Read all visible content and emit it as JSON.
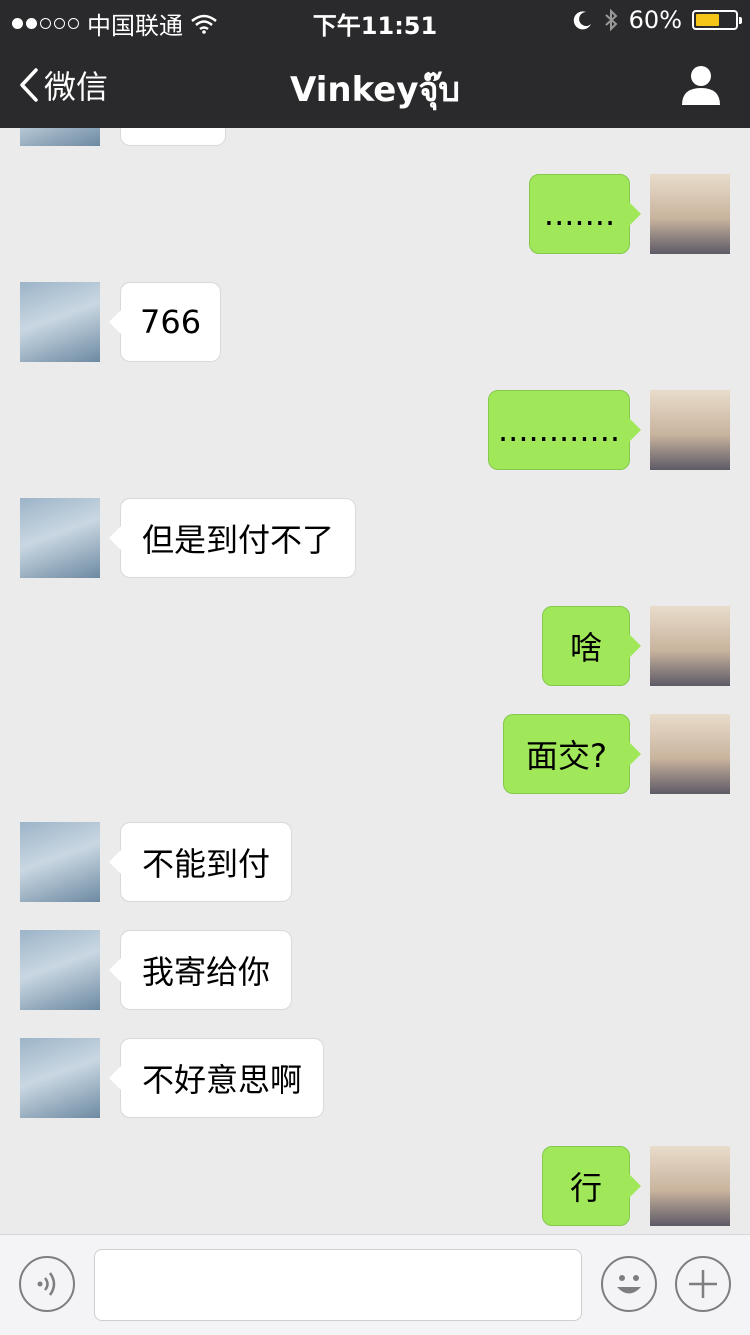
{
  "status_bar": {
    "carrier": "中国联通",
    "time": "下午11:51",
    "battery_text": "60%",
    "battery_level": 0.6,
    "signal_bars": 2
  },
  "nav": {
    "back_label": "微信",
    "title": "Vinkeyจุ๊บ"
  },
  "messages": [
    {
      "side": "right",
      "text": "......."
    },
    {
      "side": "left",
      "text": "766"
    },
    {
      "side": "right",
      "text": "............"
    },
    {
      "side": "left",
      "text": "但是到付不了"
    },
    {
      "side": "right",
      "text": "啥"
    },
    {
      "side": "right",
      "text": "面交?"
    },
    {
      "side": "left",
      "text": "不能到付"
    },
    {
      "side": "left",
      "text": "我寄给你"
    },
    {
      "side": "left",
      "text": "不好意思啊"
    },
    {
      "side": "right",
      "text": "行"
    }
  ],
  "input": {
    "value": "",
    "placeholder": ""
  },
  "colors": {
    "bar_bg": "#2a2a2c",
    "sent_bubble": "#a0e75a",
    "received_bubble": "#ffffff",
    "chat_bg": "#ebebeb",
    "battery": "#f5c518"
  },
  "icons": {
    "voice": "voice-icon",
    "emoji": "emoji-icon",
    "plus": "plus-icon",
    "profile": "profile-icon",
    "back": "chevron-left-icon"
  }
}
